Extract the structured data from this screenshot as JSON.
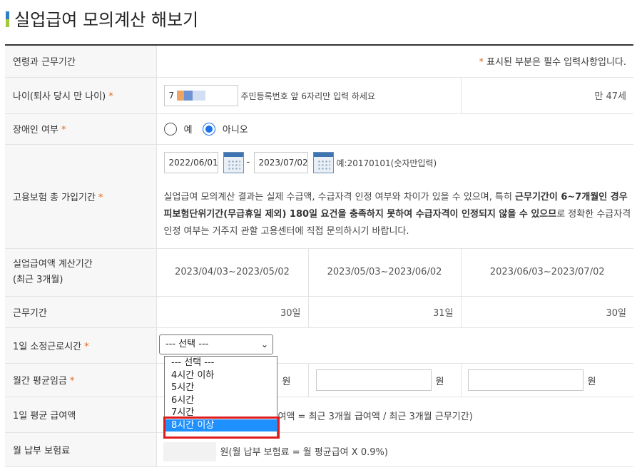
{
  "title": "실업급여 모의계산 해보기",
  "header_row": {
    "label": "연령과 근무기간",
    "required_note": "표시된 부분은 필수 입력사항입니다.",
    "star": "*"
  },
  "age": {
    "label": "나이(퇴사 당시 만 나이)",
    "value": "7",
    "hint": "주민등록번호 앞 6자리만 입력 하세요",
    "result": "만 47세"
  },
  "disabled": {
    "label": "장애인 여부",
    "option_yes": "예",
    "option_no": "아니오",
    "selected": "아니오"
  },
  "insurance": {
    "label": "고용보험 총 가입기간",
    "start_date": "2022/06/01",
    "separator": "-",
    "end_date": "2023/07/02",
    "example": "예:20170101(숫자만입력)",
    "notice_1": "실업급여 모의계산 결과는 실제 수급액, 수급자격 인정 여부와 차이가 있을 수 있으며, 특히 ",
    "notice_bold": "근무기간이 6~7개월인 경우 피보험단위기간(무급휴일 제외) 180일 요건을 충족하지 못하여 수급자격이 인정되지 않을 수 있으므",
    "notice_2": "로 정확한 수급자격 인정 여부는 거주지 관할 고용센터에 직접 문의하시기 바랍니다."
  },
  "calc_period": {
    "label_line1": "실업급여액 계산기간",
    "label_line2": "(최근 3개월)",
    "periods": [
      "2023/04/03~2023/05/02",
      "2023/05/03~2023/06/02",
      "2023/06/03~2023/07/02"
    ]
  },
  "work_days": {
    "label": "근무기간",
    "values": [
      "30일",
      "31일",
      "30일"
    ]
  },
  "daily_hours": {
    "label": "1일 소정근로시간",
    "selected": "--- 선택 ---",
    "options": [
      "--- 선택 ---",
      "4시간 이하",
      "5시간",
      "6시간",
      "7시간",
      "8시간 이상"
    ],
    "highlighted": "8시간 이상"
  },
  "monthly_wage": {
    "label": "월간 평균임금",
    "unit": "원"
  },
  "daily_benefit": {
    "label": "1일 평균 급여액",
    "formula": "여액 = 최근 3개월 급여액 / 최근 3개월 근무기간)"
  },
  "insurance_fee": {
    "label": "월 납부 보험료",
    "formula": "원(월 납부 보험료 = 월 평균급여 X 0.9%)"
  },
  "colors": {
    "accent_blue": "#1a73e8",
    "required_star": "#e2661d",
    "highlight": "#1e90ff",
    "annotation_red": "#e01b1b"
  }
}
